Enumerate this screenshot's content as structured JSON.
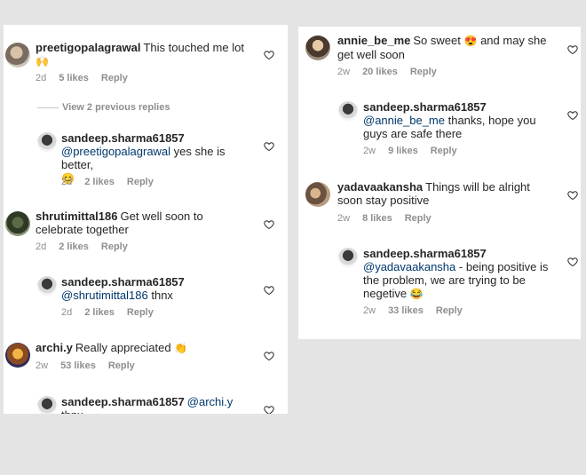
{
  "left": {
    "c1": {
      "user": "preetigopalagrawal",
      "text": "This touched me lot",
      "emoji": "🙌",
      "time": "2d",
      "likes": "5 likes",
      "reply": "Reply"
    },
    "view_previous": "View 2 previous replies",
    "r1": {
      "user": "sandeep.sharma61857",
      "mention": "@preetigopalagrawal",
      "text": " yes she is better,",
      "emoji": "😊",
      "time": "2d",
      "likes": "2 likes",
      "reply": "Reply"
    },
    "c2": {
      "user": "shrutimittal186",
      "text": "Get well soon to celebrate together",
      "time": "2d",
      "likes": "2 likes",
      "reply": "Reply"
    },
    "r2": {
      "user": "sandeep.sharma61857",
      "mention": "@shrutimittal186",
      "text": " thnx",
      "time": "2d",
      "likes": "2 likes",
      "reply": "Reply"
    },
    "c3": {
      "user": "archi.y",
      "text": "Really appreciated",
      "emoji": "👏",
      "time": "2w",
      "likes": "53 likes",
      "reply": "Reply"
    },
    "r3": {
      "user": "sandeep.sharma61857",
      "mention": "@archi.y",
      "text": "thnx"
    }
  },
  "right": {
    "c1": {
      "user": "annie_be_me",
      "text": "So sweet",
      "emoji": "😍",
      "text2": "and may she get well soon",
      "time": "2w",
      "likes": "20 likes",
      "reply": "Reply"
    },
    "r1": {
      "user": "sandeep.sharma61857",
      "mention": "@annie_be_me",
      "text": " thanks, hope you guys are safe there",
      "time": "2w",
      "likes": "9 likes",
      "reply": "Reply"
    },
    "c2": {
      "user": "yadavaakansha",
      "text": "Things will be alright soon stay positive",
      "time": "2w",
      "likes": "8 likes",
      "reply": "Reply"
    },
    "r2": {
      "user": "sandeep.sharma61857",
      "mention": "@yadavaakansha",
      "text": " - being positive is the problem, we are trying to be negetive",
      "emoji": "😂",
      "time": "2w",
      "likes": "33 likes",
      "reply": "Reply"
    }
  },
  "colors": {
    "text": "#262626",
    "meta": "#8e8e8e",
    "mention": "#00376b",
    "background": "#e4e4e4",
    "panel": "#ffffff"
  },
  "icons": {
    "like": "heart-outline-icon"
  }
}
